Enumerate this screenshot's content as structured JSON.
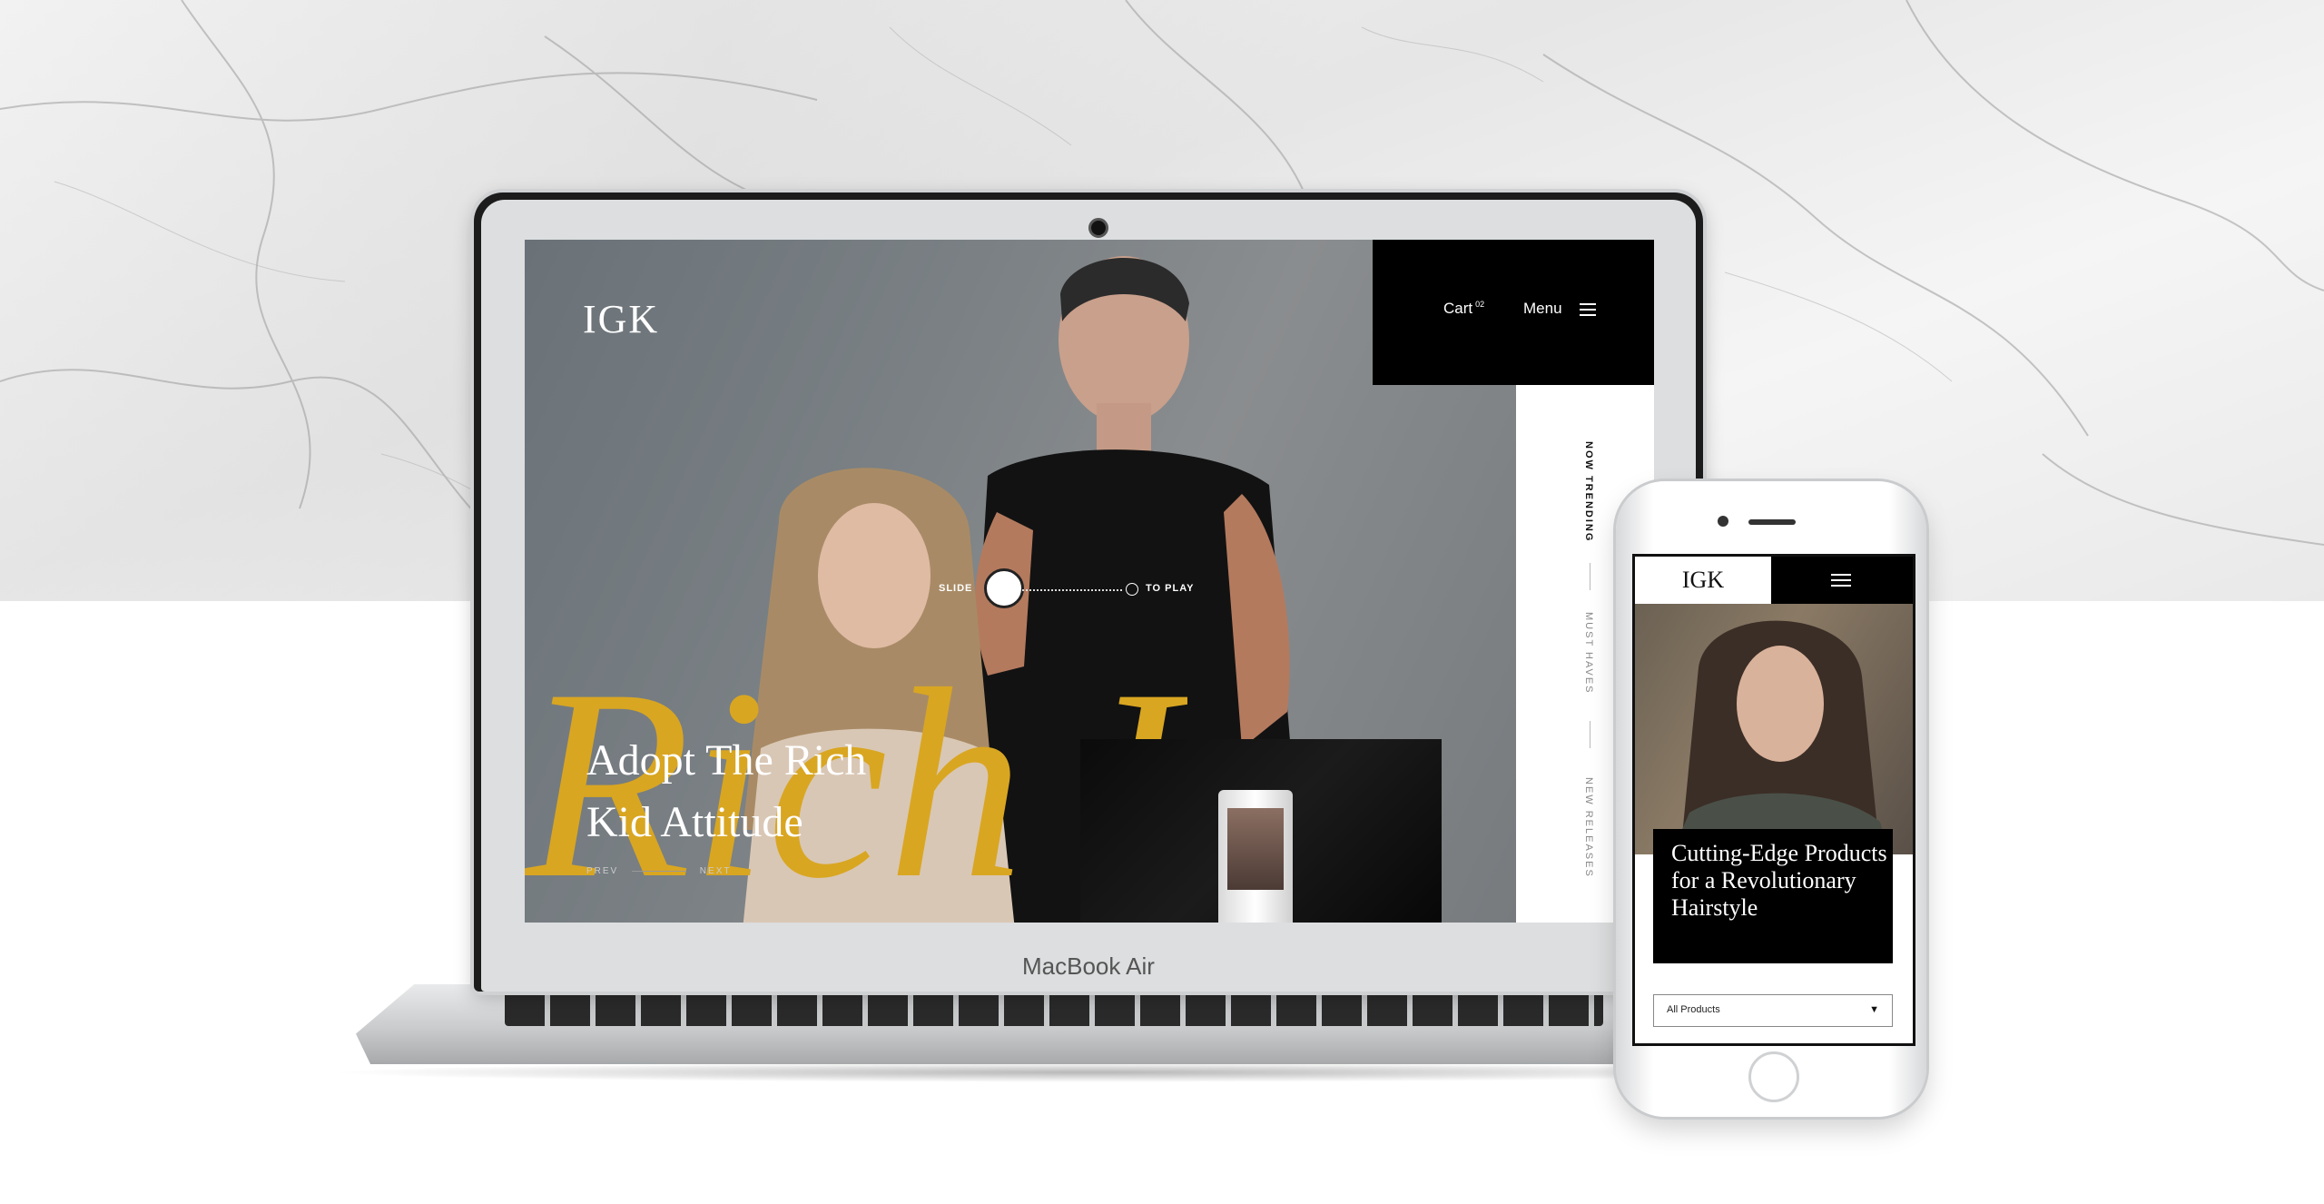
{
  "laptop": {
    "brand_label": "MacBook Air",
    "site": {
      "logo": "IGK",
      "nav": {
        "cart_label": "Cart",
        "cart_count": "02",
        "menu_label": "Menu"
      },
      "rail": [
        "NOW TRENDING",
        "MUST HAVES",
        "NEW RELEASES"
      ],
      "slider": {
        "slide_label": "SLIDE",
        "play_label": "TO PLAY"
      },
      "hero_title_line1": "Adopt The Rich",
      "hero_title_line2": "Kid Attitude",
      "hero_sub_left": "PREV",
      "hero_sub_right": "NEXT",
      "script_text": "Rich Kid"
    }
  },
  "phone": {
    "site": {
      "logo": "IGK",
      "card_title": "Cutting-Edge Products for a Revolutionary Hairstyle",
      "filter_label": "All Products",
      "filter_arrow": "▼"
    }
  },
  "colors": {
    "gold_script": "#d9a621",
    "nav_black": "#000000",
    "hero_grey": "#7a8084"
  }
}
